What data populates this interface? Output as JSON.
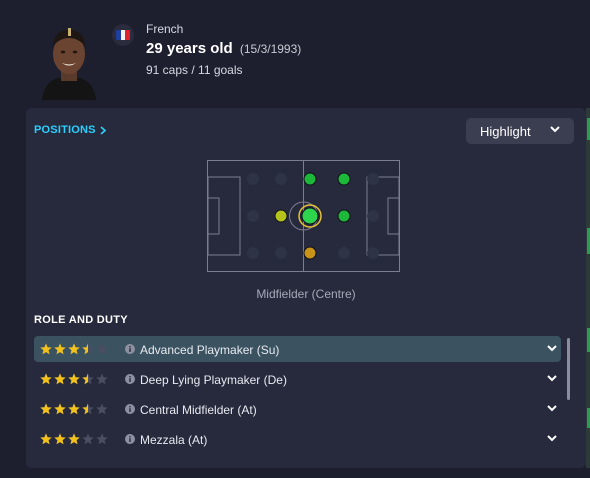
{
  "player": {
    "nationality": "French",
    "age_text": "29 years old",
    "dob_text": "(15/3/1993)",
    "caps_text": "91 caps / 11 goals",
    "flag_colors": [
      "#1f3fa0",
      "#f4f4f4",
      "#e0222f"
    ]
  },
  "positions": {
    "link_label": "POSITIONS",
    "highlight_label": "Highlight",
    "caption": "Midfielder (Centre)",
    "dot_colors": {
      "natural": "#2fd44e",
      "accomplished": "#1db83a",
      "competent": "#b6c21c",
      "unconvincing": "#c9931a",
      "empty": "#2f3346"
    }
  },
  "roles": {
    "title": "ROLE AND DUTY",
    "items": [
      {
        "label": "Advanced Playmaker (Su)",
        "stars": 3.5,
        "selected": true
      },
      {
        "label": "Deep Lying Playmaker (De)",
        "stars": 3.5,
        "selected": false
      },
      {
        "label": "Central Midfielder (At)",
        "stars": 3.5,
        "selected": false
      },
      {
        "label": "Mezzala (At)",
        "stars": 3,
        "selected": false
      }
    ]
  },
  "colors": {
    "star": "#f2c21b",
    "star_empty": "#4a4e60",
    "accent": "#2ad0ff"
  }
}
